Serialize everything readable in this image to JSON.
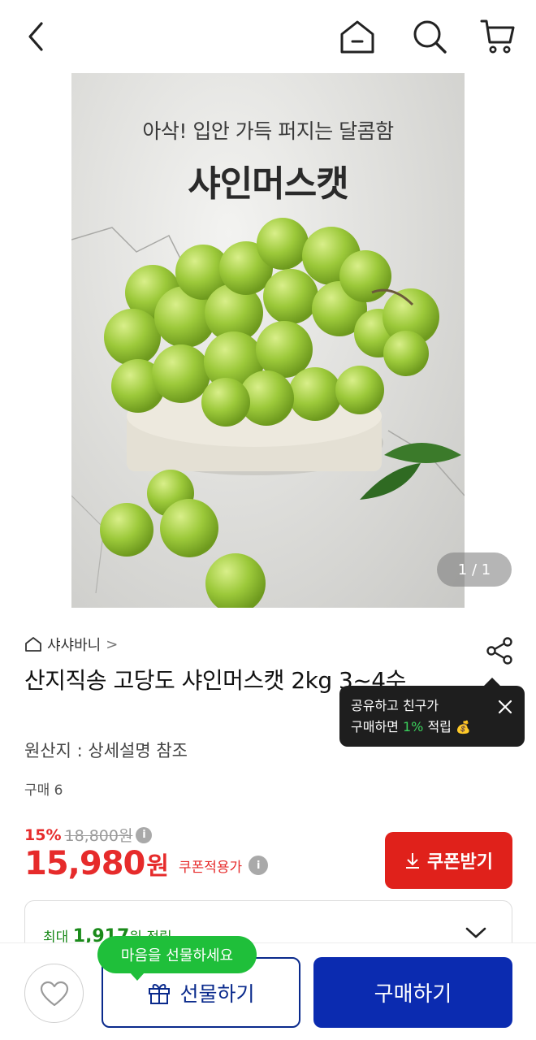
{
  "hero": {
    "subtitle": "아삭! 입안 가득 퍼지는 달콤함",
    "title": "샤인머스캣",
    "page_indicator": "1 / 1"
  },
  "product": {
    "seller": "샤샤바니",
    "seller_arrow": ">",
    "title": "산지직송 고당도 샤인머스캣 2kg 3~4수",
    "origin": "원산지 : 상세설명 참조",
    "purchase_count": "구매 6"
  },
  "share_tooltip": {
    "line1": "공유하고 친구가",
    "line2_prefix": "구매하면 ",
    "line2_highlight": "1%",
    "line2_suffix": " 적립",
    "emoji": "💰"
  },
  "pricing": {
    "discount_rate": "15%",
    "original_price": "18,800원",
    "price": "15,980",
    "price_unit": "원",
    "coupon_applied": "쿠폰적용가",
    "coupon_button": "쿠폰받기",
    "info_glyph": "i"
  },
  "points": {
    "prefix": "최대 ",
    "amount": "1,917",
    "suffix": "원 적립"
  },
  "bottom_bar": {
    "gift_bubble": "마음을 선물하세요",
    "gift_button": "선물하기",
    "buy_button": "구매하기"
  },
  "colors": {
    "accent_red": "#e0211b",
    "brand_blue": "#0b2bb0",
    "point_green": "#1fbf3a"
  },
  "icons": [
    "back-icon",
    "home-icon",
    "search-icon",
    "cart-icon",
    "share-icon",
    "close-icon",
    "info-icon",
    "download-icon",
    "chevron-down-icon",
    "heart-icon",
    "gift-icon",
    "store-icon"
  ]
}
